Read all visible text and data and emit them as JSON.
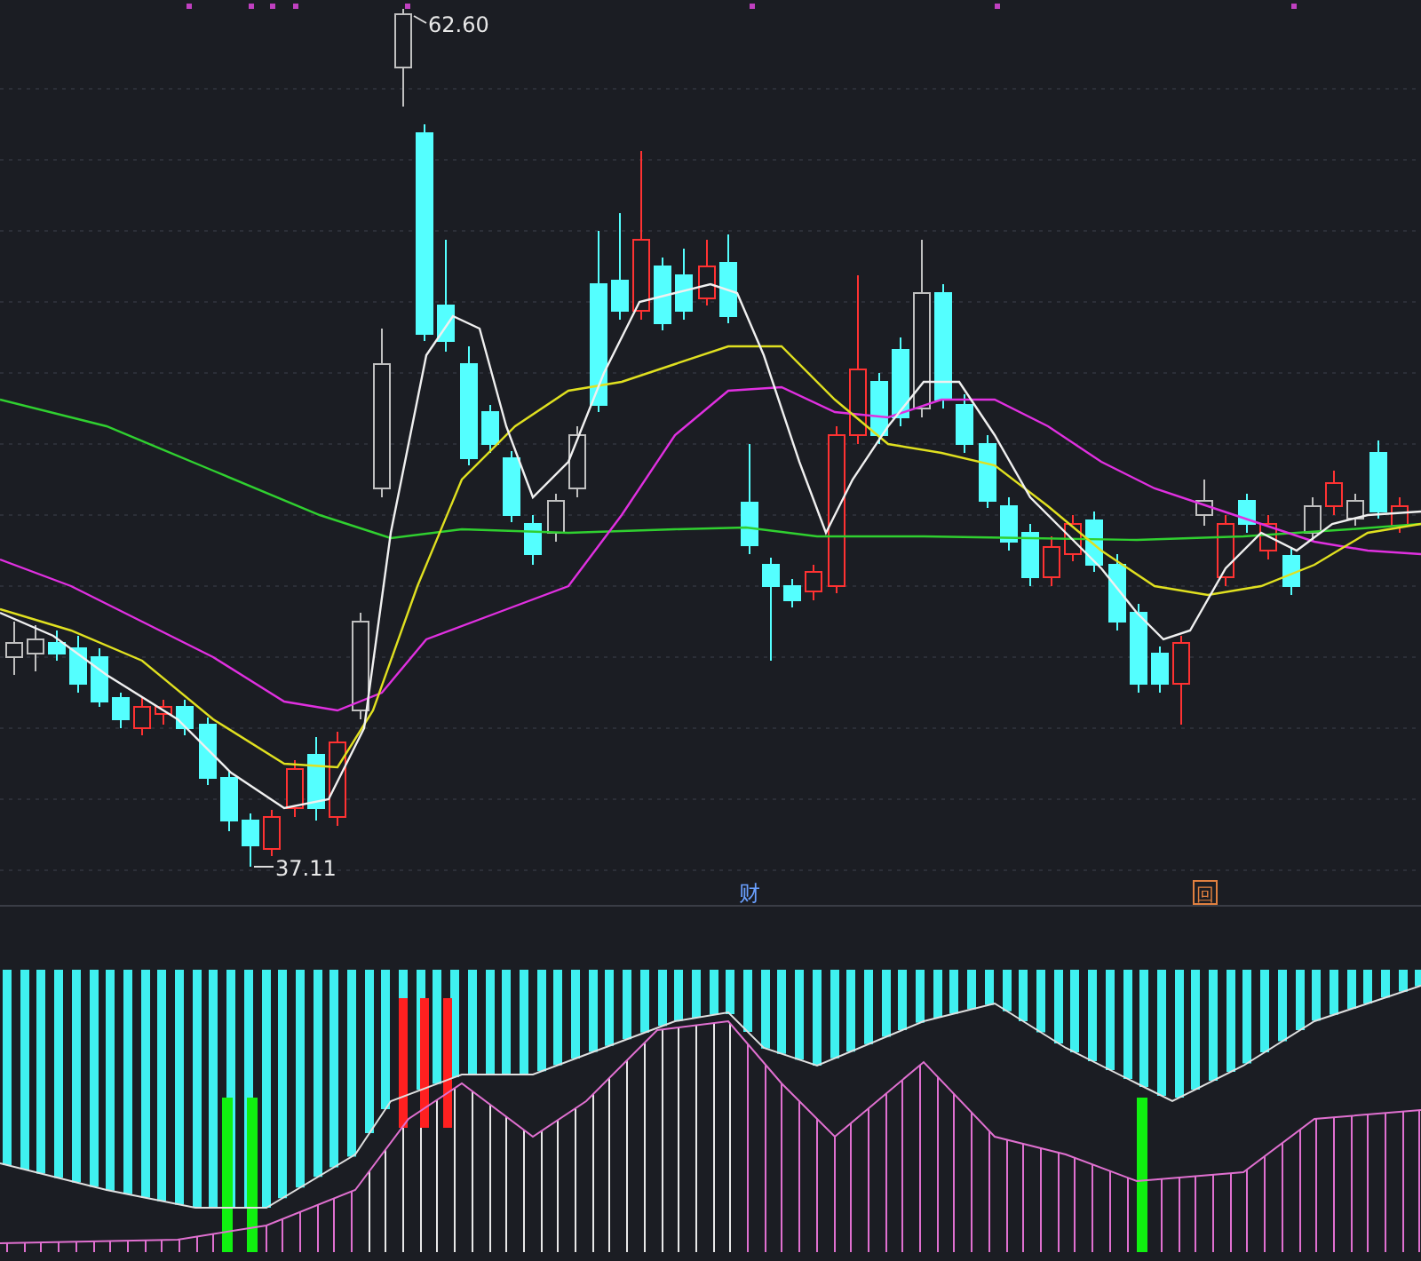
{
  "price_chart": {
    "high_label": "62.60",
    "low_label": "37.11",
    "markers": [
      {
        "kind": "text",
        "text": "财"
      },
      {
        "kind": "boxed",
        "text": "回"
      }
    ]
  }
}
